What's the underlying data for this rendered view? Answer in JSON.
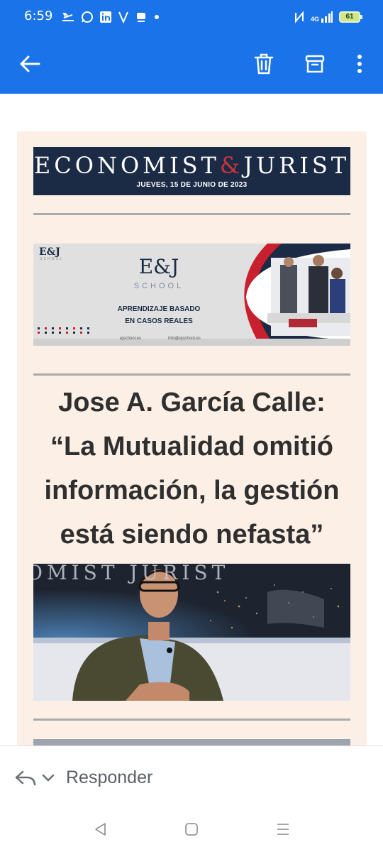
{
  "status_bar": {
    "time": "6:59",
    "network": "4G",
    "battery": "61",
    "colors": {
      "background": "#1a73e8"
    }
  },
  "app_bar": {
    "back_icon": "arrow-left-icon",
    "actions": [
      "trash-icon",
      "archive-icon",
      "more-vertical-icon"
    ]
  },
  "email": {
    "newsletter": {
      "brand_left": "ECONOMIST",
      "brand_amp": "&",
      "brand_right": "JURIST",
      "date": "JUEVES, 15 DE JUNIO DE 2023",
      "colors": {
        "banner": "#1c2b45",
        "accent": "#c7343c",
        "card": "#fcefe6"
      }
    },
    "ad": {
      "logo_small": "E&J",
      "logo_small_sub": "SCHOOL",
      "logo_big": "E&J",
      "logo_school": "SCHOOL",
      "tagline_line1": "APRENDIZAJE BASADO",
      "tagline_line2": "EN CASOS REALES",
      "website": "ejschool.es",
      "email": "info@ejschool.es"
    },
    "article": {
      "headline_line1": "Jose A. García Calle:",
      "headline_line2": "“La Mutualidad omitió",
      "headline_line3": "información, la gestión",
      "headline_line4": "está siendo nefasta”",
      "photo_backdrop_text": "OMIST JURIST"
    }
  },
  "reply_bar": {
    "label": "Responder"
  },
  "nav_bar": {
    "buttons": [
      "back-triangle-icon",
      "home-square-icon",
      "recents-menu-icon"
    ]
  }
}
